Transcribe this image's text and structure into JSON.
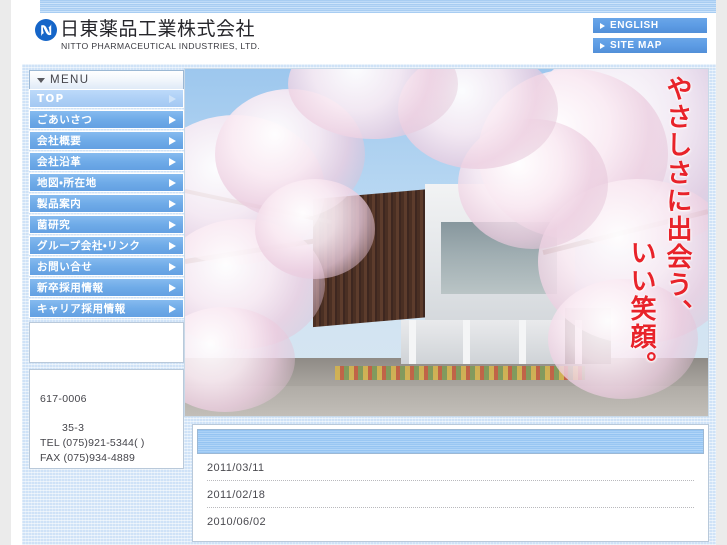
{
  "header": {
    "logo_icon": "nitto-n-mark-logo",
    "company_jp": "日東薬品工業株式会社",
    "company_en": "NITTO PHARMACEUTICAL INDUSTRIES, LTD.",
    "buttons": [
      {
        "label": "ENGLISH",
        "icon": "triangle-right-icon"
      },
      {
        "label": "SITE MAP",
        "icon": "triangle-right-icon"
      }
    ]
  },
  "sidebar": {
    "menu_title": "MENU",
    "menu_caret_icon": "triangle-down-icon",
    "items": [
      {
        "label": "TOP",
        "active": true
      },
      {
        "label": "ごあいさつ",
        "active": false
      },
      {
        "label": "会社概要",
        "active": false
      },
      {
        "label": "会社沿革",
        "active": false
      },
      {
        "label": "地図・所在地",
        "active": false
      },
      {
        "label": "製品案内",
        "active": false
      },
      {
        "label": "菌研究",
        "active": false
      },
      {
        "label": "グループ会社・リンク",
        "active": false
      },
      {
        "label": "お問い合せ",
        "active": false
      },
      {
        "label": "新卒採用情報",
        "active": false
      },
      {
        "label": "キャリア採用情報",
        "active": false
      }
    ],
    "info": {
      "zip": "617-0006",
      "address": "35-3",
      "tel": "TEL (075)921-5344( )",
      "fax": "FAX (075)934-4889"
    }
  },
  "hero": {
    "tagline_line1": "やさしさに出会う、",
    "tagline_line2": "いい笑顔。",
    "tagline_color": "#e8232a",
    "photo_description": "cherry-blossom-and-office-building-photo"
  },
  "news": {
    "items": [
      {
        "date": "2011/03/11"
      },
      {
        "date": "2011/02/18"
      },
      {
        "date": "2010/06/02"
      }
    ]
  },
  "colors": {
    "accent_blue": "#63a0e2",
    "panel_blue": "#95c4f2",
    "page_bg": "#cfe2f7",
    "red": "#e8232a"
  }
}
